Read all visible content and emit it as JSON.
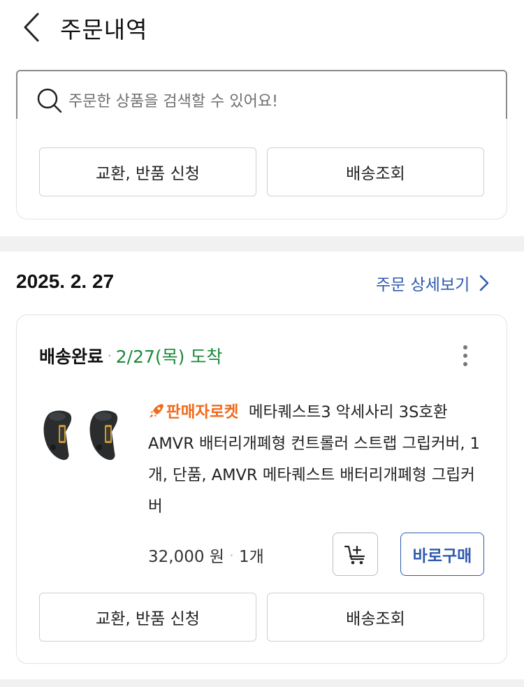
{
  "header": {
    "title": "주문내역"
  },
  "search": {
    "placeholder": "주문한 상품을 검색할 수 있어요!"
  },
  "previous_order": {
    "exchange_label": "교환, 반품 신청",
    "tracking_label": "배송조회"
  },
  "order": {
    "date": "2025. 2. 27",
    "detail_link": "주문 상세보기",
    "status": "배송완료",
    "arrival": "2/27(목) 도착",
    "badge": "판매자로켓",
    "product_name": "메타퀘스트3 악세사리 3S호환 AMVR 배터리개폐형 컨트롤러 스트랩 그립커버, 1개, 단품, AMVR 메타퀘스트 배터리개폐형 그립커버",
    "price": "32,000 원",
    "quantity": "1개",
    "buy_now_label": "바로구매",
    "exchange_label": "교환, 반품 신청",
    "tracking_label": "배송조회"
  },
  "colors": {
    "link_blue": "#2f5aae",
    "status_green": "#1a8a3a",
    "rocket_orange": "#f06a1d"
  },
  "icons": [
    "back-arrow-icon",
    "search-icon",
    "chevron-right-icon",
    "more-vertical-icon",
    "rocket-icon",
    "add-to-cart-icon"
  ]
}
